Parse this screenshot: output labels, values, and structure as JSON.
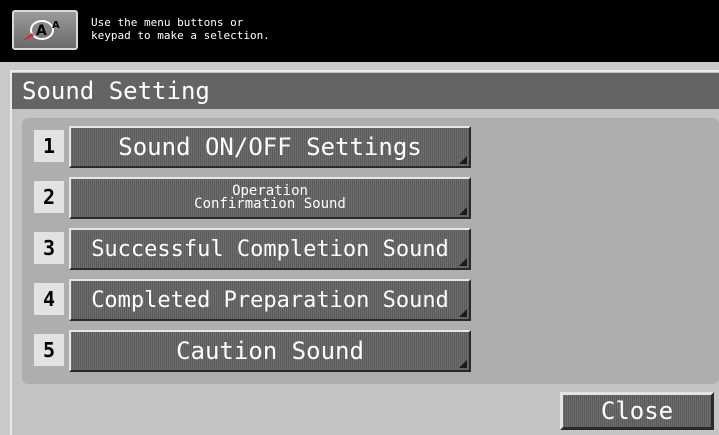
{
  "header": {
    "icon": "accessibility-icon",
    "message": "Use the menu buttons or\nkeypad to make a selection."
  },
  "page": {
    "title": "Sound Setting"
  },
  "menu": [
    {
      "number": "1",
      "label": "Sound ON/OFF Settings"
    },
    {
      "number": "2",
      "label": "Operation\nConfirmation Sound"
    },
    {
      "number": "3",
      "label": "Successful Completion Sound"
    },
    {
      "number": "4",
      "label": "Completed Preparation Sound"
    },
    {
      "number": "5",
      "label": "Caution Sound"
    }
  ],
  "footer": {
    "close_label": "Close"
  }
}
